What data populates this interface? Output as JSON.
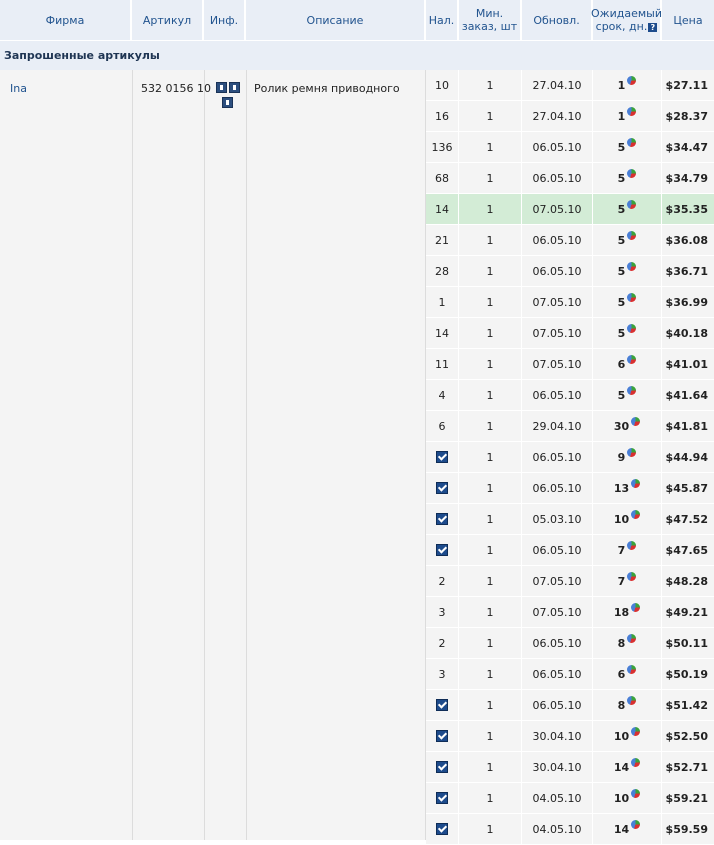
{
  "header": {
    "firm": "Фирма",
    "sku": "Артикул",
    "info": "Инф.",
    "description": "Описание",
    "stock": "Нал.",
    "min_order_1": "Мин.",
    "min_order_2": "заказ, шт",
    "updated": "Обновл.",
    "expected_1": "Ожидаемый",
    "expected_2": "срок, дн.",
    "help": "?",
    "price": "Цена"
  },
  "section_title": "Запрошенные артикулы",
  "item": {
    "firm": "Ina",
    "sku": "532 0156 10",
    "description": "Ролик ремня приводного"
  },
  "offers": [
    {
      "stock": "10",
      "min": "1",
      "date": "27.04.10",
      "days": "1",
      "price": "$27.11"
    },
    {
      "stock": "16",
      "min": "1",
      "date": "27.04.10",
      "days": "1",
      "price": "$28.37"
    },
    {
      "stock": "136",
      "min": "1",
      "date": "06.05.10",
      "days": "5",
      "price": "$34.47"
    },
    {
      "stock": "68",
      "min": "1",
      "date": "06.05.10",
      "days": "5",
      "price": "$34.79"
    },
    {
      "stock": "14",
      "min": "1",
      "date": "07.05.10",
      "days": "5",
      "price": "$35.35",
      "highlight": true
    },
    {
      "stock": "21",
      "min": "1",
      "date": "06.05.10",
      "days": "5",
      "price": "$36.08"
    },
    {
      "stock": "28",
      "min": "1",
      "date": "06.05.10",
      "days": "5",
      "price": "$36.71"
    },
    {
      "stock": "1",
      "min": "1",
      "date": "07.05.10",
      "days": "5",
      "price": "$36.99"
    },
    {
      "stock": "14",
      "min": "1",
      "date": "07.05.10",
      "days": "5",
      "price": "$40.18"
    },
    {
      "stock": "11",
      "min": "1",
      "date": "07.05.10",
      "days": "6",
      "price": "$41.01"
    },
    {
      "stock": "4",
      "min": "1",
      "date": "06.05.10",
      "days": "5",
      "price": "$41.64"
    },
    {
      "stock": "6",
      "min": "1",
      "date": "29.04.10",
      "days": "30",
      "price": "$41.81"
    },
    {
      "stock": "",
      "check": true,
      "min": "1",
      "date": "06.05.10",
      "days": "9",
      "price": "$44.94"
    },
    {
      "stock": "",
      "check": true,
      "min": "1",
      "date": "06.05.10",
      "days": "13",
      "price": "$45.87"
    },
    {
      "stock": "",
      "check": true,
      "min": "1",
      "date": "05.03.10",
      "days": "10",
      "price": "$47.52"
    },
    {
      "stock": "",
      "check": true,
      "min": "1",
      "date": "06.05.10",
      "days": "7",
      "price": "$47.65"
    },
    {
      "stock": "2",
      "min": "1",
      "date": "07.05.10",
      "days": "7",
      "price": "$48.28"
    },
    {
      "stock": "3",
      "min": "1",
      "date": "07.05.10",
      "days": "18",
      "price": "$49.21"
    },
    {
      "stock": "2",
      "min": "1",
      "date": "06.05.10",
      "days": "8",
      "price": "$50.11"
    },
    {
      "stock": "3",
      "min": "1",
      "date": "06.05.10",
      "days": "6",
      "price": "$50.19"
    },
    {
      "stock": "",
      "check": true,
      "min": "1",
      "date": "06.05.10",
      "days": "8",
      "price": "$51.42"
    },
    {
      "stock": "",
      "check": true,
      "min": "1",
      "date": "30.04.10",
      "days": "10",
      "price": "$52.50"
    },
    {
      "stock": "",
      "check": true,
      "min": "1",
      "date": "30.04.10",
      "days": "14",
      "price": "$52.71"
    },
    {
      "stock": "",
      "check": true,
      "min": "1",
      "date": "04.05.10",
      "days": "10",
      "price": "$59.21"
    },
    {
      "stock": "",
      "check": true,
      "min": "1",
      "date": "04.05.10",
      "days": "14",
      "price": "$59.59"
    }
  ],
  "colors": {
    "header_bg": "#e9eef6",
    "header_text": "#22548f",
    "row_bg": "#f4f4f4",
    "highlight": "#d3ecd6"
  }
}
